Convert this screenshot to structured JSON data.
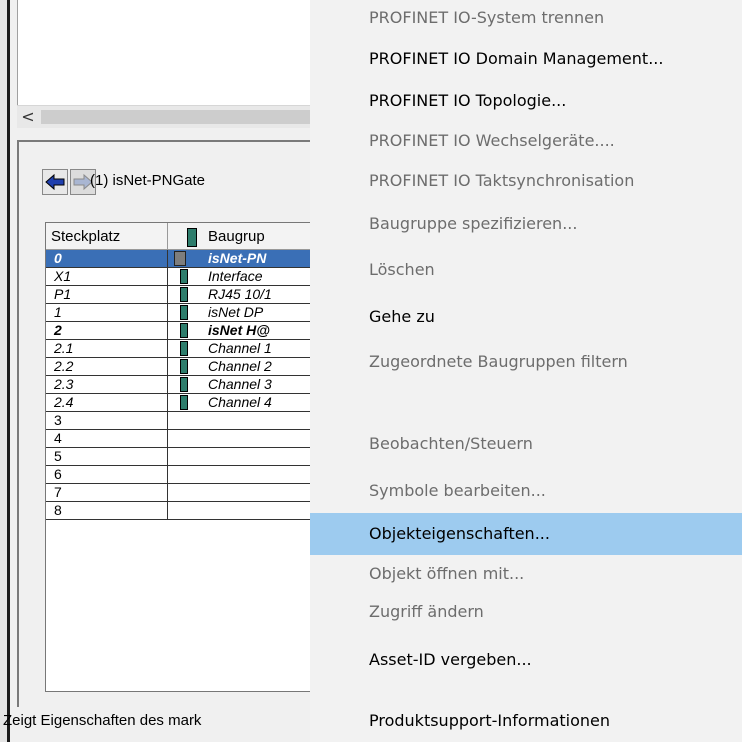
{
  "left_panel": {
    "scroll_left_glyph": "<",
    "station_title": "(1)  isNet-PNGate",
    "table": {
      "headers": [
        "Steckplatz",
        "Baugrup"
      ],
      "rows": [
        {
          "slot": "0",
          "module": "isNet-PN",
          "style": "sel"
        },
        {
          "slot": "X1",
          "module": "Interface",
          "style": "italic"
        },
        {
          "slot": "P1",
          "module": "RJ45 10/1",
          "style": "italic"
        },
        {
          "slot": "1",
          "module": "isNet DP",
          "style": "italic"
        },
        {
          "slot": "2",
          "module": "isNet H@",
          "style": "bold"
        },
        {
          "slot": "2.1",
          "module": "Channel 1",
          "style": "italic"
        },
        {
          "slot": "2.2",
          "module": "Channel 2",
          "style": "italic"
        },
        {
          "slot": "2.3",
          "module": "Channel 3",
          "style": "italic"
        },
        {
          "slot": "2.4",
          "module": "Channel 4",
          "style": "italic"
        },
        {
          "slot": "3",
          "module": "",
          "style": "plain"
        },
        {
          "slot": "4",
          "module": "",
          "style": "plain"
        },
        {
          "slot": "5",
          "module": "",
          "style": "plain"
        },
        {
          "slot": "6",
          "module": "",
          "style": "plain"
        },
        {
          "slot": "7",
          "module": "",
          "style": "plain"
        },
        {
          "slot": "8",
          "module": "",
          "style": "plain"
        }
      ]
    },
    "status_text": "Zeigt Eigenschaften des mark"
  },
  "context_menu": {
    "items": [
      {
        "label": "PROFINET IO-System trennen",
        "enabled": false
      },
      {
        "label": "PROFINET IO Domain Management...",
        "enabled": true
      },
      {
        "label": "PROFINET IO Topologie...",
        "enabled": true
      },
      {
        "label": "PROFINET IO Wechselgeräte....",
        "enabled": false
      },
      {
        "label": "PROFINET IO Taktsynchronisation",
        "enabled": false
      },
      {
        "label": "Baugruppe spezifizieren...",
        "enabled": false
      },
      {
        "label": "Löschen",
        "enabled": false
      },
      {
        "label": "Gehe zu",
        "enabled": true
      },
      {
        "label": "Zugeordnete Baugruppen filtern",
        "enabled": false
      },
      {
        "label": "Beobachten/Steuern",
        "enabled": false
      },
      {
        "label": "Symbole bearbeiten...",
        "enabled": false
      },
      {
        "label": "Objekteigenschaften...",
        "enabled": true,
        "highlighted": true
      },
      {
        "label": "Objekt öffnen mit...",
        "enabled": false
      },
      {
        "label": "Zugriff ändern",
        "enabled": false
      },
      {
        "label": "Asset-ID vergeben...",
        "enabled": true
      },
      {
        "label": "Produktsupport-Informationen",
        "enabled": true
      }
    ]
  },
  "colors": {
    "selection": "#3a6fb6",
    "menu_highlight": "#9dcbef",
    "menu_bg": "#f2f2f2",
    "disabled_text": "#6d6d6d"
  }
}
